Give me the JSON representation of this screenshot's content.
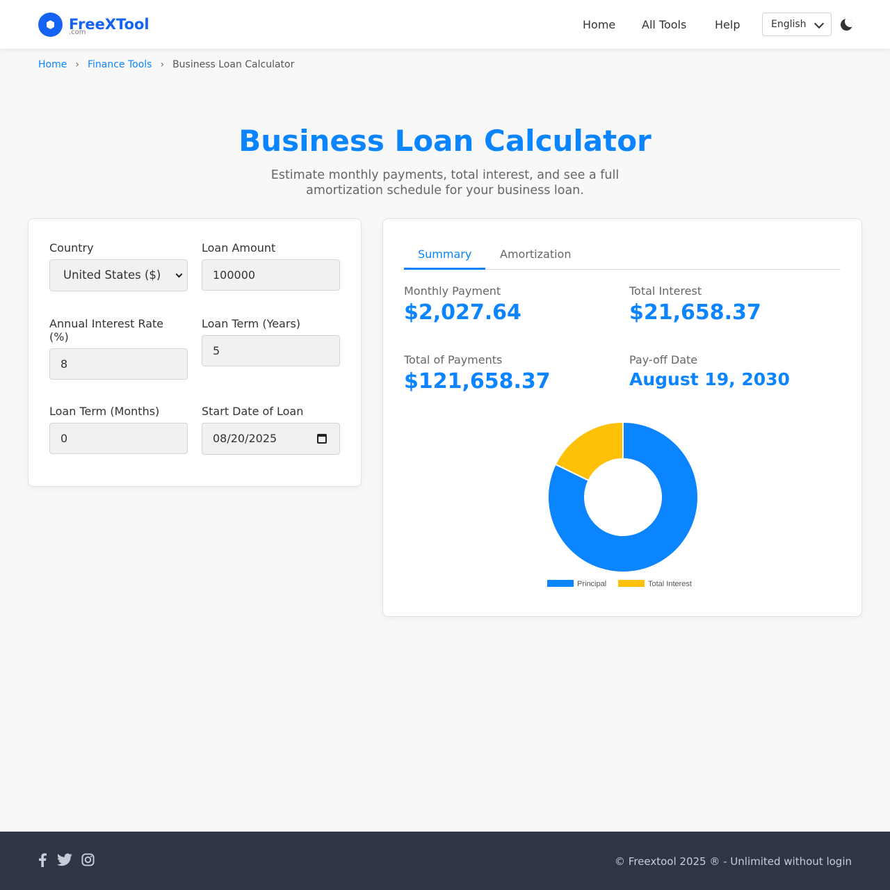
{
  "header": {
    "logo_name": "FreeXTool",
    "logo_suffix": ".com",
    "nav": [
      "Home",
      "All Tools",
      "Help"
    ],
    "language": "English"
  },
  "breadcrumb": {
    "home": "Home",
    "category": "Finance Tools",
    "current": "Business Loan Calculator"
  },
  "page": {
    "title": "Business Loan Calculator",
    "subtitle": "Estimate monthly payments, total interest, and see a full amortization schedule for your business loan."
  },
  "form": {
    "country_label": "Country",
    "country_value": "United States ($)",
    "amount_label": "Loan Amount",
    "amount_value": "100000",
    "rate_label": "Annual Interest Rate (%)",
    "rate_value": "8",
    "years_label": "Loan Term (Years)",
    "years_value": "5",
    "months_label": "Loan Term (Months)",
    "months_value": "0",
    "start_label": "Start Date of Loan",
    "start_value": "08/20/2025"
  },
  "results": {
    "tabs": [
      "Summary",
      "Amortization"
    ],
    "monthly_label": "Monthly Payment",
    "monthly_value": "$2,027.64",
    "interest_label": "Total Interest",
    "interest_value": "$21,658.37",
    "total_label": "Total of Payments",
    "total_value": "$121,658.37",
    "payoff_label": "Pay-off Date",
    "payoff_value": "August 19, 2030"
  },
  "colors": {
    "accent": "#0a84ff",
    "principal": "#0a84ff",
    "interest": "#ffc107",
    "footer_bg": "#2e3646"
  },
  "chart_data": {
    "type": "pie",
    "categories": [
      "Principal",
      "Total Interest"
    ],
    "values": [
      100000,
      21658.37
    ],
    "legend": "bottom"
  },
  "footer": {
    "icons": [
      "facebook-icon",
      "twitter-icon",
      "instagram-icon"
    ],
    "copyright": "© Freextool 2025 ® - Unlimited without login"
  }
}
